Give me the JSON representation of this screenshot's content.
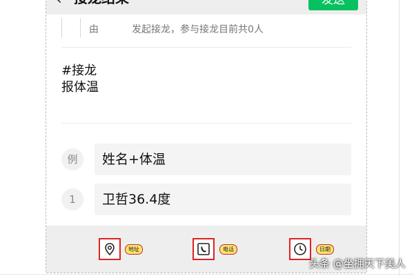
{
  "header": {
    "title": "接龙结果",
    "send_label": "发送"
  },
  "initiator": {
    "by_label": "由",
    "description": "发起接龙，参与接龙目前共0人"
  },
  "topic": {
    "line1": "#接龙",
    "line2": "报体温"
  },
  "entries": [
    {
      "index": "例",
      "text": "姓名+体温"
    },
    {
      "index": "1",
      "text": "卫哲36.4度"
    }
  ],
  "toolbar": {
    "items": [
      {
        "icon": "location-pin-icon",
        "label": "地址"
      },
      {
        "icon": "phone-icon",
        "label": "电话"
      },
      {
        "icon": "clock-icon",
        "label": "日期"
      }
    ]
  },
  "watermark": "头条 @坐拥天下美人",
  "colors": {
    "send_button": "#07c160",
    "highlight_border": "#e02020",
    "tag_fill": "#ffe46a"
  }
}
